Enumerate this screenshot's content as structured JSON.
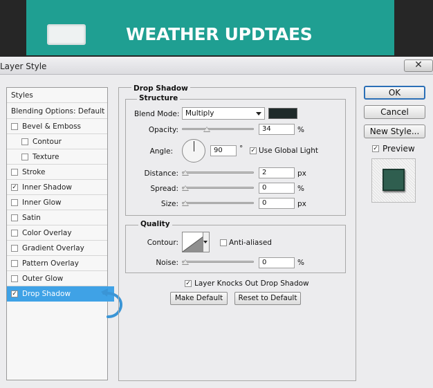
{
  "banner": {
    "title": "WEATHER UPDTAES",
    "color": "#1f9f92"
  },
  "dialog": {
    "title": "Layer Style",
    "close_glyph": "✕"
  },
  "styles_list": {
    "header": "Styles",
    "items": [
      {
        "label": "Blending Options: Default",
        "has_checkbox": false,
        "checked": false
      },
      {
        "label": "Bevel & Emboss",
        "has_checkbox": true,
        "checked": false
      },
      {
        "label": "Contour",
        "has_checkbox": true,
        "checked": false,
        "indent": true
      },
      {
        "label": "Texture",
        "has_checkbox": true,
        "checked": false,
        "indent": true
      },
      {
        "label": "Stroke",
        "has_checkbox": true,
        "checked": false
      },
      {
        "label": "Inner Shadow",
        "has_checkbox": true,
        "checked": true
      },
      {
        "label": "Inner Glow",
        "has_checkbox": true,
        "checked": false
      },
      {
        "label": "Satin",
        "has_checkbox": true,
        "checked": false
      },
      {
        "label": "Color Overlay",
        "has_checkbox": true,
        "checked": false
      },
      {
        "label": "Gradient Overlay",
        "has_checkbox": true,
        "checked": false
      },
      {
        "label": "Pattern Overlay",
        "has_checkbox": true,
        "checked": false
      },
      {
        "label": "Outer Glow",
        "has_checkbox": true,
        "checked": false
      },
      {
        "label": "Drop Shadow",
        "has_checkbox": true,
        "checked": true,
        "selected": true
      }
    ],
    "check_glyph": "✓"
  },
  "drop_shadow": {
    "section_title": "Drop Shadow",
    "structure": {
      "title": "Structure",
      "blend_mode_label": "Blend Mode:",
      "blend_mode_value": "Multiply",
      "shadow_color": "#1f2a2a",
      "opacity_label": "Opacity:",
      "opacity_value": "34",
      "opacity_unit": "%",
      "angle_label": "Angle:",
      "angle_value": "90",
      "angle_unit": "°",
      "use_global_light_label": "Use Global Light",
      "use_global_light": true,
      "distance_label": "Distance:",
      "distance_value": "2",
      "distance_unit": "px",
      "spread_label": "Spread:",
      "spread_value": "0",
      "spread_unit": "%",
      "size_label": "Size:",
      "size_value": "0",
      "size_unit": "px"
    },
    "quality": {
      "title": "Quality",
      "contour_label": "Contour:",
      "anti_aliased_label": "Anti-aliased",
      "anti_aliased": false,
      "noise_label": "Noise:",
      "noise_value": "0",
      "noise_unit": "%"
    },
    "knocks_out_label": "Layer Knocks Out Drop Shadow",
    "knocks_out": true,
    "make_default_label": "Make Default",
    "reset_default_label": "Reset to Default"
  },
  "buttons": {
    "ok": "OK",
    "cancel": "Cancel",
    "new_style": "New Style...",
    "preview_label": "Preview",
    "preview_checked": true
  },
  "colors": {
    "selection": "#3fa2e6",
    "accent_arrow": "#3a95d6"
  }
}
